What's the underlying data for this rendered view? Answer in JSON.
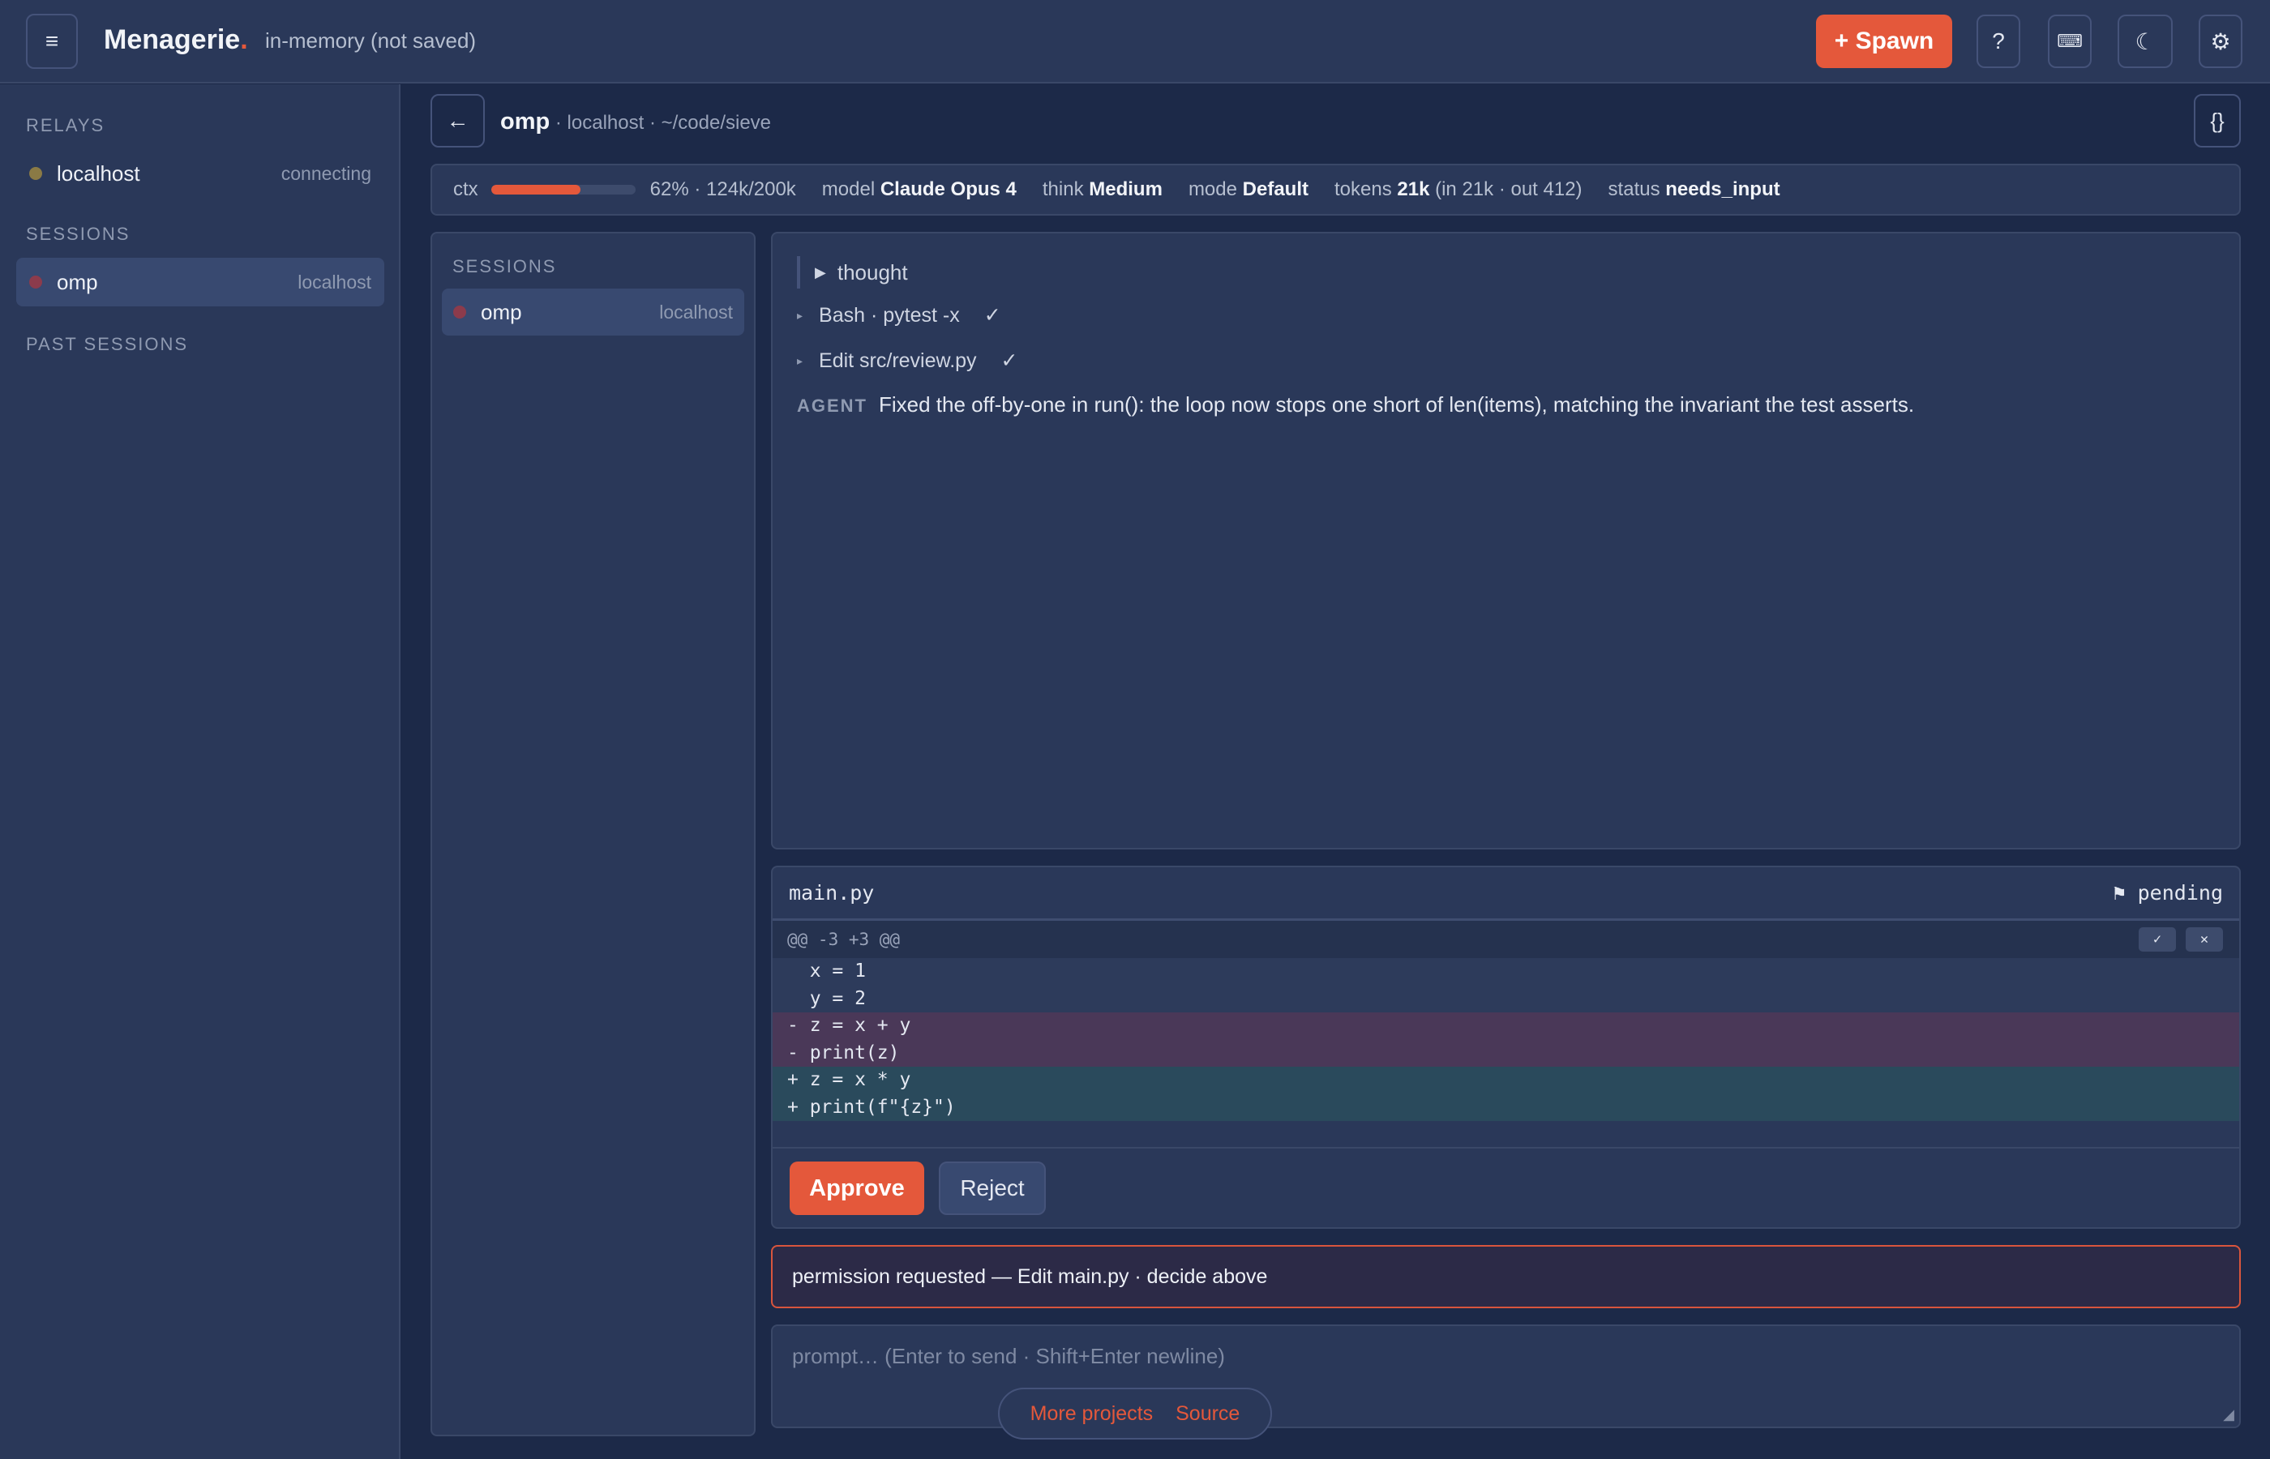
{
  "header": {
    "menu_icon": "≡",
    "brand": "Menagerie",
    "brand_dot": ".",
    "subtitle": "in-memory (not saved)",
    "spawn_label": "+ Spawn",
    "help_label": "?",
    "keyboard_icon": "⌨",
    "theme_icon": "☾",
    "settings_icon": "⚙"
  },
  "sidebar": {
    "relays_title": "RELAYS",
    "relays": [
      {
        "name": "localhost",
        "status": "connecting",
        "color": "#8a7a45"
      }
    ],
    "sessions_title": "SESSIONS",
    "sessions": [
      {
        "name": "omp",
        "host": "localhost",
        "color": "#8c3b4c"
      }
    ],
    "past_title": "PAST SESSIONS"
  },
  "session": {
    "back_icon": "←",
    "title": "omp",
    "path": " · localhost · ~/code/sieve",
    "json_label": "{}"
  },
  "status": {
    "ctx_label": "ctx",
    "ctx_fraction": 0.62,
    "ctx_text": "62% · 124k/200k",
    "model_label": "model",
    "model_value": "Claude Opus 4",
    "think_label": "think",
    "think_value": "Medium",
    "mode_label": "mode",
    "mode_value": "Default",
    "tokens_label": "tokens",
    "tokens_value": "21k",
    "tokens_detail": "(in 21k · out 412)",
    "status_label": "status",
    "status_value": "needs_input"
  },
  "inner_sessions": {
    "title": "SESSIONS",
    "items": [
      {
        "name": "omp",
        "host": "localhost",
        "color": "#8c3b4c"
      }
    ]
  },
  "conversation": {
    "thought_label": "thought",
    "thought_icon": "▶",
    "tools": [
      {
        "label": "Bash · pytest -x",
        "check": "✓"
      },
      {
        "label": "Edit src/review.py",
        "check": "✓"
      }
    ],
    "tool_icon": "▸",
    "agent_label": "AGENT",
    "agent_text": "Fixed the off-by-one in run(): the loop now stops one short of len(items), matching the invariant the test asserts."
  },
  "diff": {
    "filename": "main.py",
    "status": "⚑ pending",
    "hunk": "@@ -3 +3 @@",
    "accept_icon": "✓",
    "reject_icon": "✕",
    "lines": [
      {
        "type": "ctx",
        "text": "  x = 1"
      },
      {
        "type": "ctx",
        "text": "  y = 2"
      },
      {
        "type": "del",
        "text": "- z = x + y"
      },
      {
        "type": "del",
        "text": "- print(z)"
      },
      {
        "type": "add",
        "text": "+ z = x * y"
      },
      {
        "type": "add",
        "text": "+ print(f\"{z}\")"
      }
    ],
    "approve_label": "Approve",
    "reject_label": "Reject"
  },
  "permission": {
    "text": "permission requested — Edit main.py · decide above"
  },
  "prompt": {
    "placeholder": "prompt… (Enter to send · Shift+Enter newline)"
  },
  "footer_links": {
    "more": "More projects",
    "source": "Source"
  }
}
